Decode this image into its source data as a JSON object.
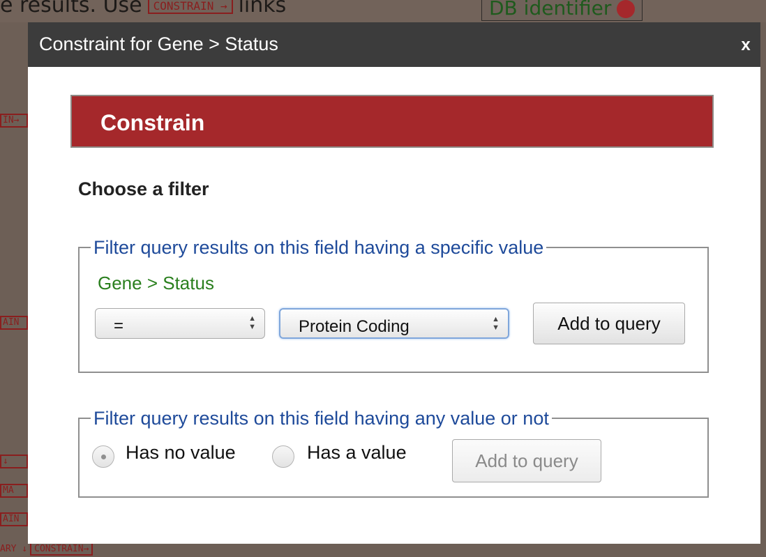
{
  "background": {
    "top_left_text": "e results. Use",
    "top_left_button": "CONSTRAIN →",
    "top_left_suffix": "links",
    "top_right_text": "DB identifier",
    "left_tags": [
      "IN→",
      "AIN",
      "↓",
      "MA",
      "AIN"
    ],
    "bottom_text": "ARY ↓",
    "bottom_button": "CONSTRAIN→"
  },
  "dialog": {
    "title": "Constraint for Gene > Status",
    "close_label": "x",
    "banner": "Constrain",
    "choose_label": "Choose a filter",
    "specific_value": {
      "legend": "Filter query results on this field having a specific value",
      "path": "Gene > Status",
      "operator": "=",
      "value": "Protein Coding",
      "add_button": "Add to query"
    },
    "any_value": {
      "legend": "Filter query results on this field having any value or not",
      "option_no_value": "Has no value",
      "option_has_value": "Has a value",
      "selected": "Has no value",
      "add_button": "Add to query"
    }
  },
  "colors": {
    "banner": "#a5282b",
    "header": "#3c3c3c",
    "legend": "#1e4a9a",
    "path": "#2a7f1e"
  },
  "icons": {
    "close": "close-icon",
    "select_arrows": "up-down-arrows-icon"
  }
}
